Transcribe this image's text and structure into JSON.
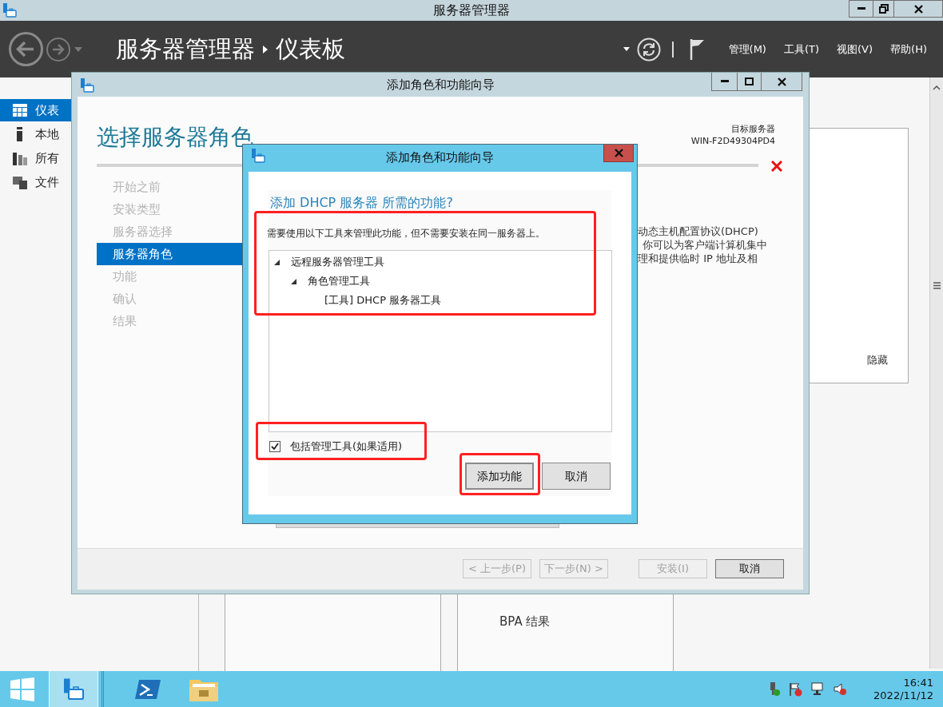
{
  "window": {
    "title": "服务器管理器"
  },
  "header": {
    "breadcrumb": [
      "服务器管理器",
      "仪表板"
    ],
    "menus": [
      "管理(M)",
      "工具(T)",
      "视图(V)",
      "帮助(H)"
    ]
  },
  "sidebar": {
    "items": [
      {
        "label": "仪表",
        "selected": true
      },
      {
        "label": "本地",
        "selected": false
      },
      {
        "label": "所有",
        "selected": false
      },
      {
        "label": "文件",
        "selected": false
      }
    ]
  },
  "dashboard": {
    "hide_link": "隐藏",
    "tile_text": "BPA 结果"
  },
  "wizard": {
    "title": "添加角色和功能向导",
    "heading": "选择服务器角色",
    "target_label": "目标服务器",
    "target_server": "WIN-F2D49304PD4",
    "steps": [
      {
        "label": "开始之前",
        "selected": false
      },
      {
        "label": "安装类型",
        "selected": false
      },
      {
        "label": "服务器选择",
        "selected": false
      },
      {
        "label": "服务器角色",
        "selected": true
      },
      {
        "label": "功能",
        "selected": false
      },
      {
        "label": "确认",
        "selected": false
      },
      {
        "label": "结果",
        "selected": false
      }
    ],
    "description_lines": [
      "动态主机配置协议(DHCP)",
      "你可以为客户端计算机集中",
      "理和提供临时 IP 地址及相"
    ],
    "buttons": [
      {
        "label": "< 上一步(P)",
        "disabled": true
      },
      {
        "label": "下一步(N) >",
        "disabled": true
      },
      {
        "label": "安装(I)",
        "disabled": true
      },
      {
        "label": "取消",
        "disabled": false
      }
    ]
  },
  "dialog": {
    "title": "添加角色和功能向导",
    "question": "添加 DHCP 服务器 所需的功能?",
    "info": "需要使用以下工具来管理此功能，但不需要安装在同一服务器上。",
    "tree": [
      {
        "label": "远程服务器管理工具",
        "expanded": true,
        "children": [
          {
            "label": "角色管理工具",
            "expanded": true,
            "children": [
              {
                "label": "[工具] DHCP 服务器工具"
              }
            ]
          }
        ]
      }
    ],
    "include_tools": {
      "label": "包括管理工具(如果适用)",
      "checked": true
    },
    "buttons": [
      "添加功能",
      "取消"
    ]
  },
  "taskbar": {
    "apps": [
      {
        "kind": "server-manager",
        "selected": true
      },
      {
        "kind": "powershell",
        "selected": false
      },
      {
        "kind": "explorer",
        "selected": false
      }
    ],
    "time": "16:41",
    "date": "2022/11/12"
  }
}
